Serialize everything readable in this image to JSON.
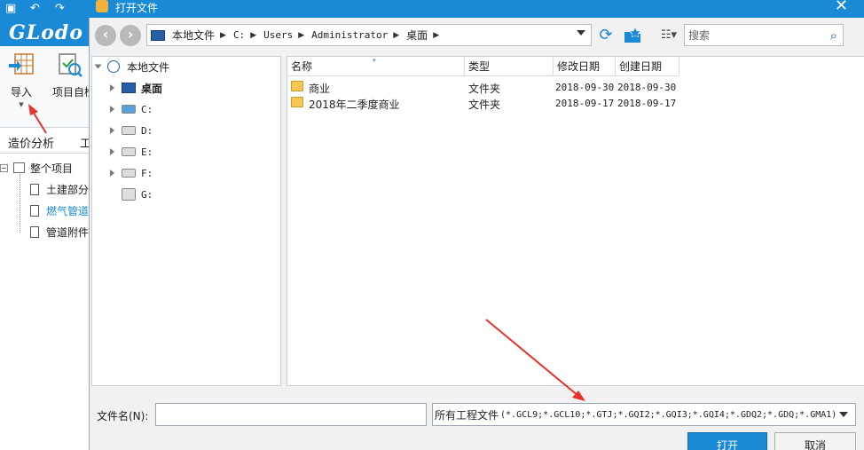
{
  "app": {
    "logo": "GLodo",
    "ribbon": {
      "import_label": "导入",
      "project_label": "项目自检"
    },
    "tabs": [
      "造价分析",
      "工"
    ],
    "tree": {
      "root": "整个项目",
      "items": [
        "土建部分",
        "燃气管道",
        "管道附件"
      ]
    }
  },
  "dialog": {
    "title": "打开文件",
    "close_label": "✕",
    "breadcrumb": [
      "本地文件",
      "C:",
      "Users",
      "Administrator",
      "桌面"
    ],
    "search_placeholder": "搜索",
    "nav_tree": {
      "root": "本地文件",
      "items": [
        "桌面",
        "C:",
        "D:",
        "E:",
        "F:",
        "G:"
      ]
    },
    "columns": [
      "名称",
      "类型",
      "修改日期",
      "创建日期"
    ],
    "files": [
      {
        "name": "商业",
        "type": "文件夹",
        "modified": "2018-09-30",
        "created": "2018-09-30"
      },
      {
        "name": "2018年二季度商业",
        "type": "文件夹",
        "modified": "2018-09-17",
        "created": "2018-09-17"
      }
    ],
    "filename_label": "文件名(N):",
    "filename_value": "",
    "filetype": {
      "label": "所有工程文件",
      "patterns": "(*.GCL9;*.GCL10;*.GTJ;*.GQI2;*.GQI3;*.GQI4;*.GDQ2;*.GDQ;*.GMA1)"
    },
    "open_label": "打开",
    "cancel_label": "取消"
  },
  "colors": {
    "accent": "#1a8ad6",
    "annotation_arrow": "#e8322c",
    "folder": "#f4c852"
  }
}
